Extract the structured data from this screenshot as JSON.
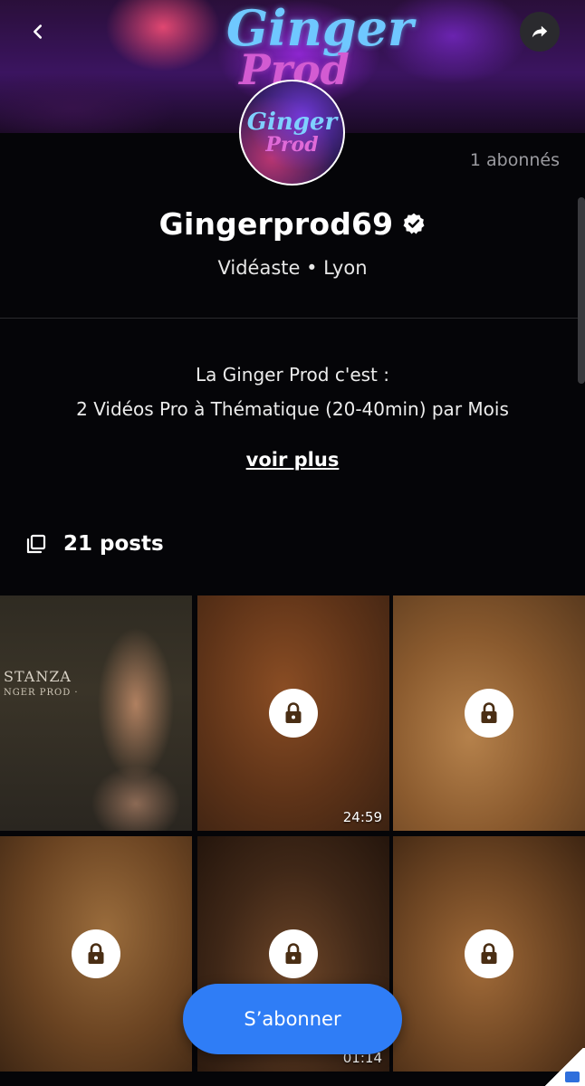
{
  "header": {
    "banner_logo_line1": "Ginger",
    "banner_logo_line2": "Prod",
    "back_icon": "chevron-left-icon",
    "share_icon": "share-arrow-icon"
  },
  "profile": {
    "avatar_line1": "Ginger",
    "avatar_line2": "Prod",
    "subscribers": "1 abonnés",
    "name": "Gingerprod69",
    "verified_icon": "verified-badge-icon",
    "profession": "Vidéaste • Lyon",
    "bio_line1": "La Ginger Prod c'est :",
    "bio_line2": "2 Vidéos Pro à Thématique (20-40min) par Mois",
    "see_more": "voir plus"
  },
  "posts": {
    "icon": "copy-stack-icon",
    "count_label": "21 posts",
    "tiles": [
      {
        "locked": false,
        "cushion_text": "STANZA",
        "cushion_sub": "NGER PROD ·"
      },
      {
        "locked": true,
        "duration": "24:59"
      },
      {
        "locked": true
      },
      {
        "locked": true
      },
      {
        "locked": true,
        "duration": "01:14"
      },
      {
        "locked": true
      }
    ]
  },
  "actions": {
    "subscribe_label": "S’abonner"
  },
  "colors": {
    "accent": "#2f7df6",
    "background": "#050508"
  }
}
